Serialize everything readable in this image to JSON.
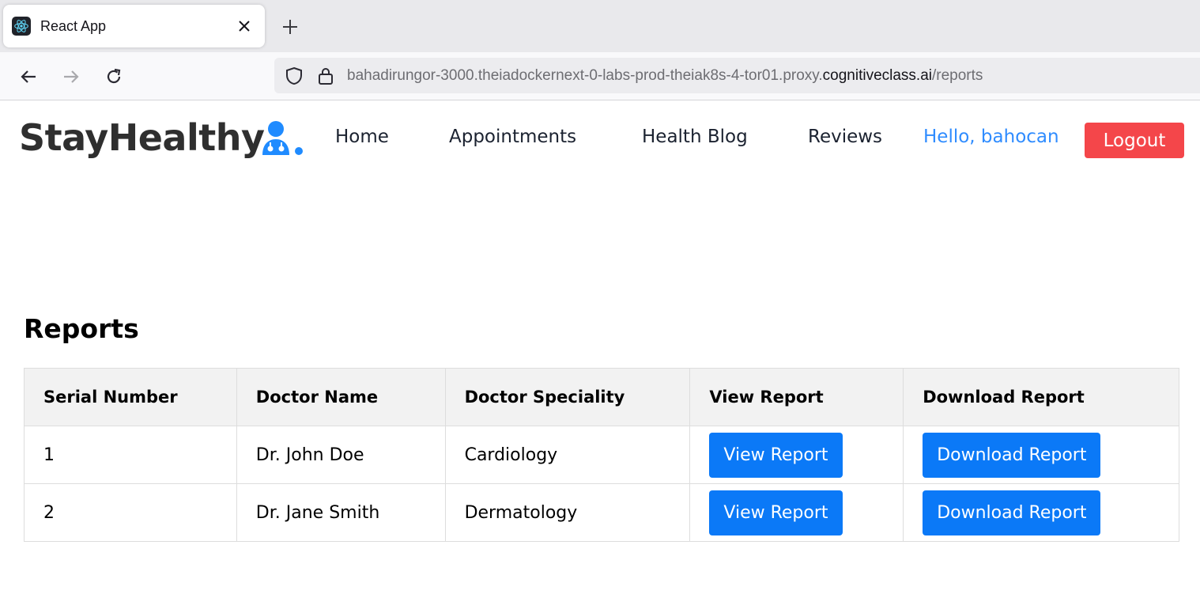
{
  "browser": {
    "tab_title": "React App",
    "url_prefix": "bahadirungor-3000.theiadockernext-0-labs-prod-theiak8s-4-tor01.proxy.",
    "url_host": "cognitiveclass.ai",
    "url_suffix": "/reports"
  },
  "app": {
    "brand": "StayHealthy",
    "nav": {
      "home": "Home",
      "appointments": "Appointments",
      "health_blog": "Health Blog",
      "reviews": "Reviews"
    },
    "greeting": "Hello, bahocan",
    "logout_label": "Logout",
    "colors": {
      "accent": "#0b79f7",
      "logout": "#f4464a",
      "greeting": "#2f8cff"
    }
  },
  "reports": {
    "title": "Reports",
    "columns": [
      "Serial Number",
      "Doctor Name",
      "Doctor Speciality",
      "View Report",
      "Download Report"
    ],
    "rows": [
      {
        "serial": "1",
        "doctor": "Dr. John Doe",
        "speciality": "Cardiology",
        "view_label": "View Report",
        "download_label": "Download Report"
      },
      {
        "serial": "2",
        "doctor": "Dr. Jane Smith",
        "speciality": "Dermatology",
        "view_label": "View Report",
        "download_label": "Download Report"
      }
    ]
  }
}
